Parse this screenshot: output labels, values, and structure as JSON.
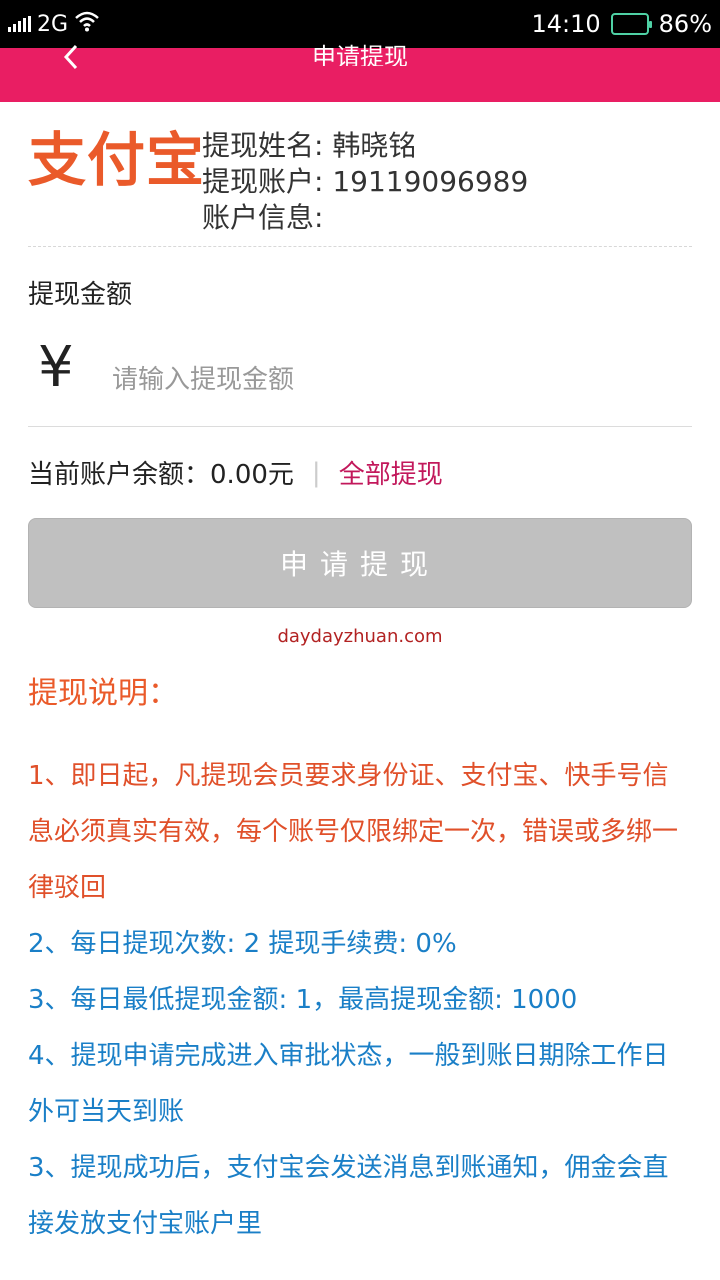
{
  "status_bar": {
    "network": "2G",
    "time": "14:10",
    "battery": "86%"
  },
  "header": {
    "title": "申请提现"
  },
  "account": {
    "provider": "支付宝",
    "name_label": "提现姓名:",
    "name": "韩晓铭",
    "account_label": "提现账户:",
    "account": "19119096989",
    "info_label": "账户信息:"
  },
  "amount": {
    "label": "提现金额",
    "currency_symbol": "¥",
    "placeholder": "请输入提现金额"
  },
  "balance": {
    "label": "当前账户余额：",
    "value": "0.00元",
    "withdraw_all": "全部提现"
  },
  "submit_label": "申请提现",
  "watermark": "daydayzhuan.com",
  "notes": {
    "title": "提现说明：",
    "items": [
      "1、即日起，凡提现会员要求身份证、支付宝、快手号信息必须真实有效，每个账号仅限绑定一次，错误或多绑一律驳回",
      "2、每日提现次数: 2 提现手续费: 0%",
      "3、每日最低提现金额: 1，最高提现金额: 1000",
      "4、提现申请完成进入审批状态，一般到账日期除工作日外可当天到账",
      "3、提现成功后，支付宝会发送消息到账通知，佣金会直接发放支付宝账户里"
    ]
  },
  "colors": {
    "header": "#e91e63",
    "brand_orange": "#ea5a2a",
    "note_blue": "#1a7fc7",
    "button_disabled": "#c0c0c0"
  }
}
